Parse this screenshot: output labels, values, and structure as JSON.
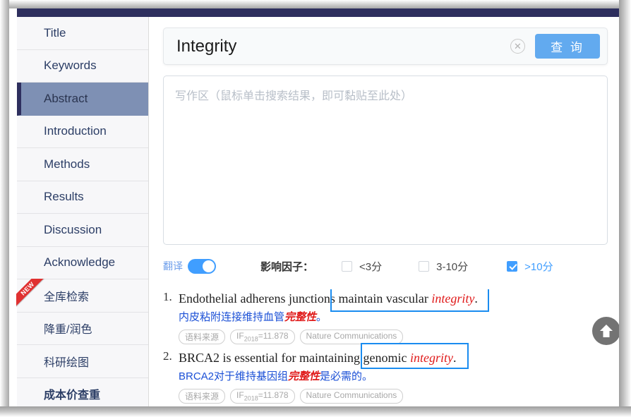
{
  "window": {
    "navbar_color": "#2e2f5e",
    "frame_color": "#a8a8a8"
  },
  "sidebar": {
    "items": [
      {
        "label": "Title",
        "active": false,
        "cn": false,
        "bold": false,
        "badge": ""
      },
      {
        "label": "Keywords",
        "active": false,
        "cn": false,
        "bold": false,
        "badge": ""
      },
      {
        "label": "Abstract",
        "active": true,
        "cn": false,
        "bold": false,
        "badge": ""
      },
      {
        "label": "Introduction",
        "active": false,
        "cn": false,
        "bold": false,
        "badge": ""
      },
      {
        "label": "Methods",
        "active": false,
        "cn": false,
        "bold": false,
        "badge": ""
      },
      {
        "label": "Results",
        "active": false,
        "cn": false,
        "bold": false,
        "badge": ""
      },
      {
        "label": "Discussion",
        "active": false,
        "cn": false,
        "bold": false,
        "badge": ""
      },
      {
        "label": "Acknowledge",
        "active": false,
        "cn": false,
        "bold": false,
        "badge": ""
      },
      {
        "label": "全库检索",
        "active": false,
        "cn": true,
        "bold": false,
        "badge": "NEW"
      },
      {
        "label": "降重/润色",
        "active": false,
        "cn": true,
        "bold": false,
        "badge": ""
      },
      {
        "label": "科研绘图",
        "active": false,
        "cn": true,
        "bold": false,
        "badge": ""
      },
      {
        "label": "成本价查重",
        "active": false,
        "cn": true,
        "bold": true,
        "badge": ""
      }
    ],
    "active_bg": "#7e90b4",
    "active_accent": "#2e2f5e"
  },
  "search": {
    "value": "Integrity",
    "placeholder": "",
    "clear_icon": "close-circle-icon",
    "button_label": "查 询",
    "button_color": "#62aaef"
  },
  "editor": {
    "placeholder": "写作区（鼠标单击搜索结果，即可黏贴至此处）",
    "value": ""
  },
  "filters": {
    "translate_label": "翻译",
    "translate_on": true,
    "impact_label": "影响因子：",
    "checkboxes": [
      {
        "label": "<3分",
        "checked": false
      },
      {
        "label": "3-10分",
        "checked": false
      },
      {
        "label": ">10分",
        "checked": true
      }
    ],
    "accent_color": "#409eff"
  },
  "results": [
    {
      "number": "1.",
      "en_before": "Endothelial adherens junctions maintain vascular ",
      "en_keyword": "integrity",
      "en_after": ".",
      "cn_before": "内皮粘附连接维持血管",
      "cn_keyword": "完整性",
      "cn_after": "。",
      "tags": [
        {
          "text": "语料来源",
          "sub": ""
        },
        {
          "text": "IF",
          "sub": "2018",
          "tail": "=11.878"
        },
        {
          "text": "Nature Communications",
          "sub": ""
        }
      ],
      "selected": true
    },
    {
      "number": "2.",
      "en_before": "BRCA2 is essential for maintaining genomic ",
      "en_keyword": "integrity",
      "en_after": ".",
      "cn_before": "BRCA2对于维持基因组",
      "cn_keyword": "完整性",
      "cn_after": "是必需的。",
      "tags": [
        {
          "text": "语料来源",
          "sub": ""
        },
        {
          "text": "IF",
          "sub": "2018",
          "tail": "=11.878"
        },
        {
          "text": "Nature Communications",
          "sub": ""
        }
      ],
      "selected": true
    }
  ],
  "back_to_top": {
    "icon": "arrow-up-icon",
    "color": "#737373"
  }
}
